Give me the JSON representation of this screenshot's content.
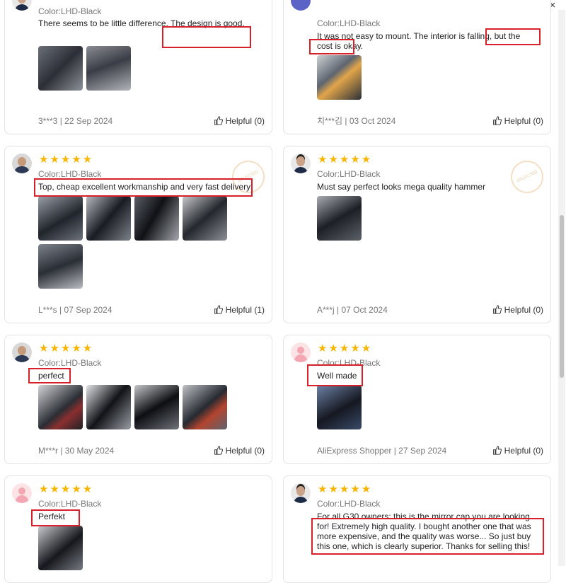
{
  "close_label": "×",
  "stars": "★★★★★",
  "helpful_prefix": "Helpful",
  "stamp_label": "SELECTED",
  "reviews": [
    {
      "color": "Color:LHD-Black",
      "text": "There seems to be little difference. The design is good.",
      "meta": "3***3 | 22 Sep 2024",
      "helpful": "Helpful (0)"
    },
    {
      "color": "Color:LHD-Black",
      "text": "It was not easy to mount. The interior is falling, but the cost is okay.",
      "meta": "치***김 | 03 Oct 2024",
      "helpful": "Helpful (0)"
    },
    {
      "color": "Color:LHD-Black",
      "text": "Top, cheap excellent workmanship and very fast delivery",
      "meta": "L***s | 07 Sep 2024",
      "helpful": "Helpful (1)"
    },
    {
      "color": "Color:LHD-Black",
      "text": "Must say perfect looks mega quality hammer",
      "meta": "A***j | 07 Oct 2024",
      "helpful": "Helpful (0)"
    },
    {
      "color": "Color:LHD-Black",
      "text": "perfect",
      "meta": "M***r | 30 May 2024",
      "helpful": "Helpful (0)"
    },
    {
      "color": "Color:LHD-Black",
      "text": "Well made",
      "meta": "AliExpress Shopper | 27 Sep 2024",
      "helpful": "Helpful (0)"
    },
    {
      "color": "Color:LHD-Black",
      "text": "Perfekt",
      "meta": "",
      "helpful": ""
    },
    {
      "color": "Color:LHD-Black",
      "text": "For all G30 owners: this is the mirror cap you are looking for! Extremely high quality. I bought another one that was more expensive, and the quality was worse... So just buy this one, which is clearly superior. Thanks for selling this!",
      "meta": "",
      "helpful": ""
    }
  ],
  "colors": {
    "star": "#f7b500",
    "highlight": "#d7202a",
    "muted": "#777777"
  }
}
